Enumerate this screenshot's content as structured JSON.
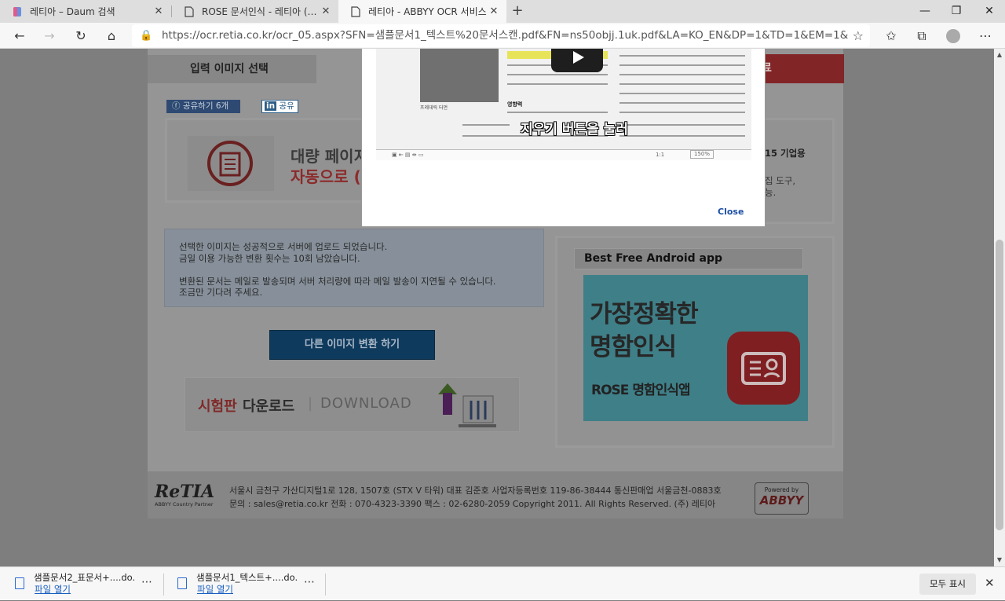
{
  "browser": {
    "tabs": [
      {
        "title": "레티아 – Daum 검색",
        "active": false
      },
      {
        "title": "ROSE 문서인식 - 레티아 (ReTIA)",
        "active": false
      },
      {
        "title": "레티아 - ABBYY OCR 서비스",
        "active": true
      }
    ],
    "url": "https://ocr.retia.co.kr/ocr_05.aspx?SFN=샘플문서1_텍스트%20문서스캔.pdf&FN=ns50objj.1uk.pdf&LA=KO_EN&DP=1&TD=1&EM=1&..."
  },
  "page": {
    "step_label": "입력 이미지 선택",
    "step_right_label": "료",
    "share_facebook": "공유하기 6개",
    "share_linkedin": "공유",
    "banner_line1": "대량 페이지",
    "banner_line2": "자동으로 (",
    "right_box_line1": "15 기업용",
    "right_box_line2": "집 도구,",
    "right_box_line3": "능.",
    "message_lines": [
      "선택한 이미지는 성공적으로 서버에 업로드 되었습니다.",
      "금일 이용 가능한 변환 횟수는 10회 남았습니다.",
      "",
      "변환된 문서는 메일로 발송되며 서버 처리량에 따라 메일 발송이 지연될 수 있습니다.",
      "조금만 기다려 주세요."
    ],
    "convert_button": "다른 이미지 변환 하기",
    "download_banner": {
      "trial": "시험판",
      "download_ko": "다운로드",
      "divider": "|",
      "download_en": "DOWNLOAD"
    },
    "ad": {
      "heading": "Best Free Android app",
      "line1": "가장정확한",
      "line2": "명함인식",
      "line3": "ROSE 명함인식앱"
    },
    "footer": {
      "logo": "ReTIA",
      "logo_sub": "ABBYY Country Partner",
      "address_line1": "서울시 금천구 가산디지털1로 128, 1507호 (STX V 타워)    대표 김준호    사업자등록번호 119-86-38444    통신판매업 서울금천-0883호",
      "address_line2": "문의 : sales@retia.co.kr    전화 : 070-4323-3390    팩스 : 02-6280-2059    Copyright 2011.  All Rights Reserved.    (주) 레티아",
      "powered_by": "Powered by",
      "abbyy": "ABBYY"
    }
  },
  "modal": {
    "caption": "지우기 버튼을 눌러",
    "close_label": "Close",
    "doc_heading": "영향력",
    "photo_caption": "프레데릭 터먼",
    "toolbar_zoom": "150%",
    "toolbar_page": "1:1"
  },
  "downloads": {
    "items": [
      {
        "name": "샘플문서2_표문서+....do...",
        "action": "파일 열기"
      },
      {
        "name": "샘플문서1_텍스트+....do...",
        "action": "파일 열기"
      }
    ],
    "show_all": "모두 표시"
  }
}
